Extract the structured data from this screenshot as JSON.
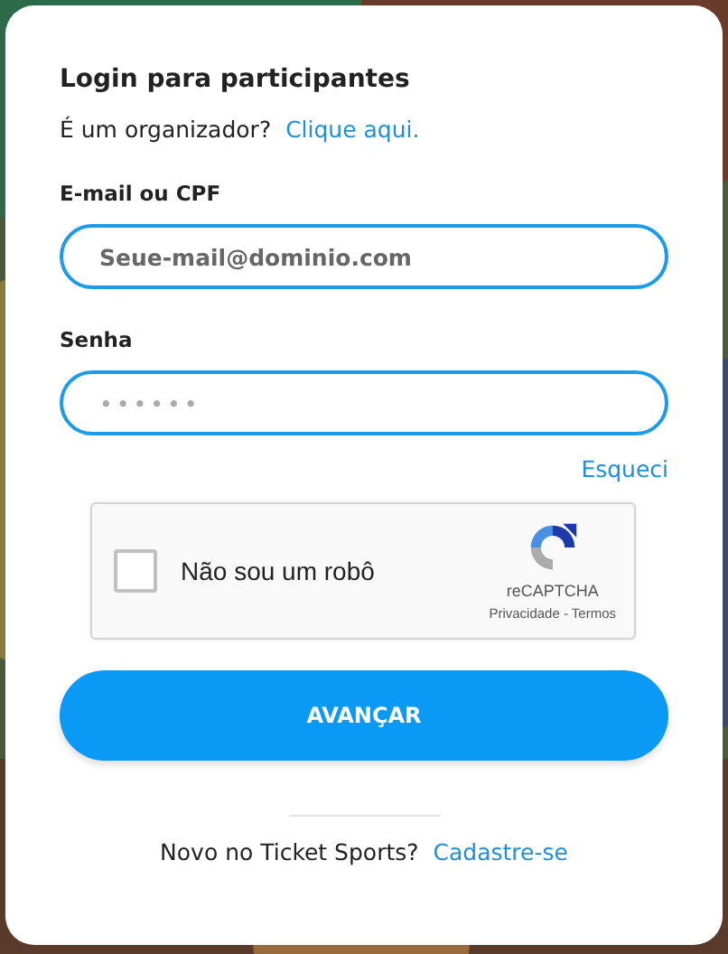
{
  "title": "Login para participantes",
  "organizer": {
    "question": "É um organizador?",
    "link": "Clique aqui."
  },
  "fields": [
    {
      "label": "E-mail ou CPF",
      "placeholder": "Seue-mail@dominio.com",
      "kind": "text"
    },
    {
      "label": "Senha",
      "placeholder": "••••••",
      "kind": "password"
    }
  ],
  "forgot_link": "Esqueci",
  "captcha": {
    "label": "Não sou um robô",
    "checked": false,
    "brand": "reCAPTCHA",
    "links": "Privacidade - Termos"
  },
  "submit": "AVANÇAR",
  "signup": {
    "question": "Novo no Ticket Sports?",
    "link": "Cadastre-se"
  }
}
